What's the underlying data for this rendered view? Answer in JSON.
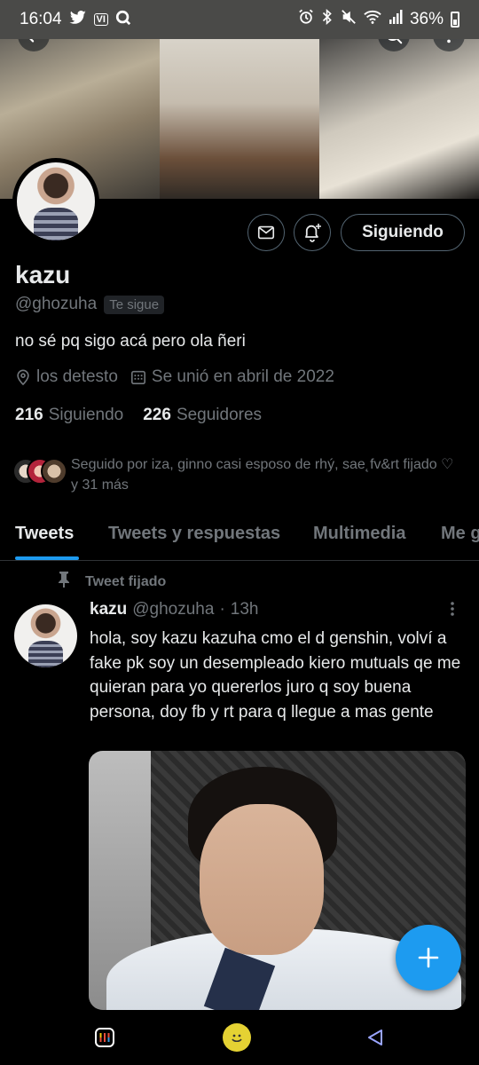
{
  "status_bar": {
    "time": "16:04",
    "left_icons": [
      "twitter-icon",
      "vi-icon",
      "q-icon"
    ],
    "right_icons": [
      "alarm-icon",
      "bluetooth-icon",
      "mute-icon",
      "wifi-icon",
      "signal-icon"
    ],
    "battery": "36%"
  },
  "banner": {
    "back_icon": "arrow-left-icon",
    "search_icon": "search-icon",
    "more_icon": "more-vertical-icon"
  },
  "actions": {
    "message_icon": "envelope-icon",
    "notify_icon": "bell-plus-icon",
    "follow_label": "Siguiendo"
  },
  "profile": {
    "name": "kazu",
    "handle": "@ghozuha",
    "follows_you": "Te sigue",
    "bio": "no sé pq sigo acá pero ola ñeri",
    "location": "los detesto",
    "joined": "Se unió en abril de 2022",
    "following_count": "216",
    "following_label": "Siguiendo",
    "followers_count": "226",
    "followers_label": "Seguidores",
    "followed_by": "Seguido por iza, ginno casi esposo de rhý, sae˛fv&rt fijado ♡ y 31 más"
  },
  "tabs": [
    {
      "label": "Tweets",
      "active": true
    },
    {
      "label": "Tweets y respuestas",
      "active": false
    },
    {
      "label": "Multimedia",
      "active": false
    },
    {
      "label": "Me g",
      "active": false
    }
  ],
  "tweet": {
    "pinned_label": "Tweet fijado",
    "name": "kazu",
    "handle": "@ghozuha",
    "separator": "·",
    "time": "13h",
    "text": "hola, soy kazu kazuha cmo el d genshin, volví a fake pk soy un desempleado kiero mutuals qe me quieran para yo quererlos juro q soy buena persona, doy fb y rt para q llegue a mas gente"
  },
  "fab": {
    "icon": "plus-icon"
  },
  "nav": {
    "icons": [
      "recents-icon",
      "home-icon",
      "back-icon"
    ]
  },
  "colors": {
    "accent": "#1d9bf0",
    "text": "#e7e9ea",
    "muted": "#71767b",
    "border": "#2f3336",
    "background": "#000000"
  }
}
